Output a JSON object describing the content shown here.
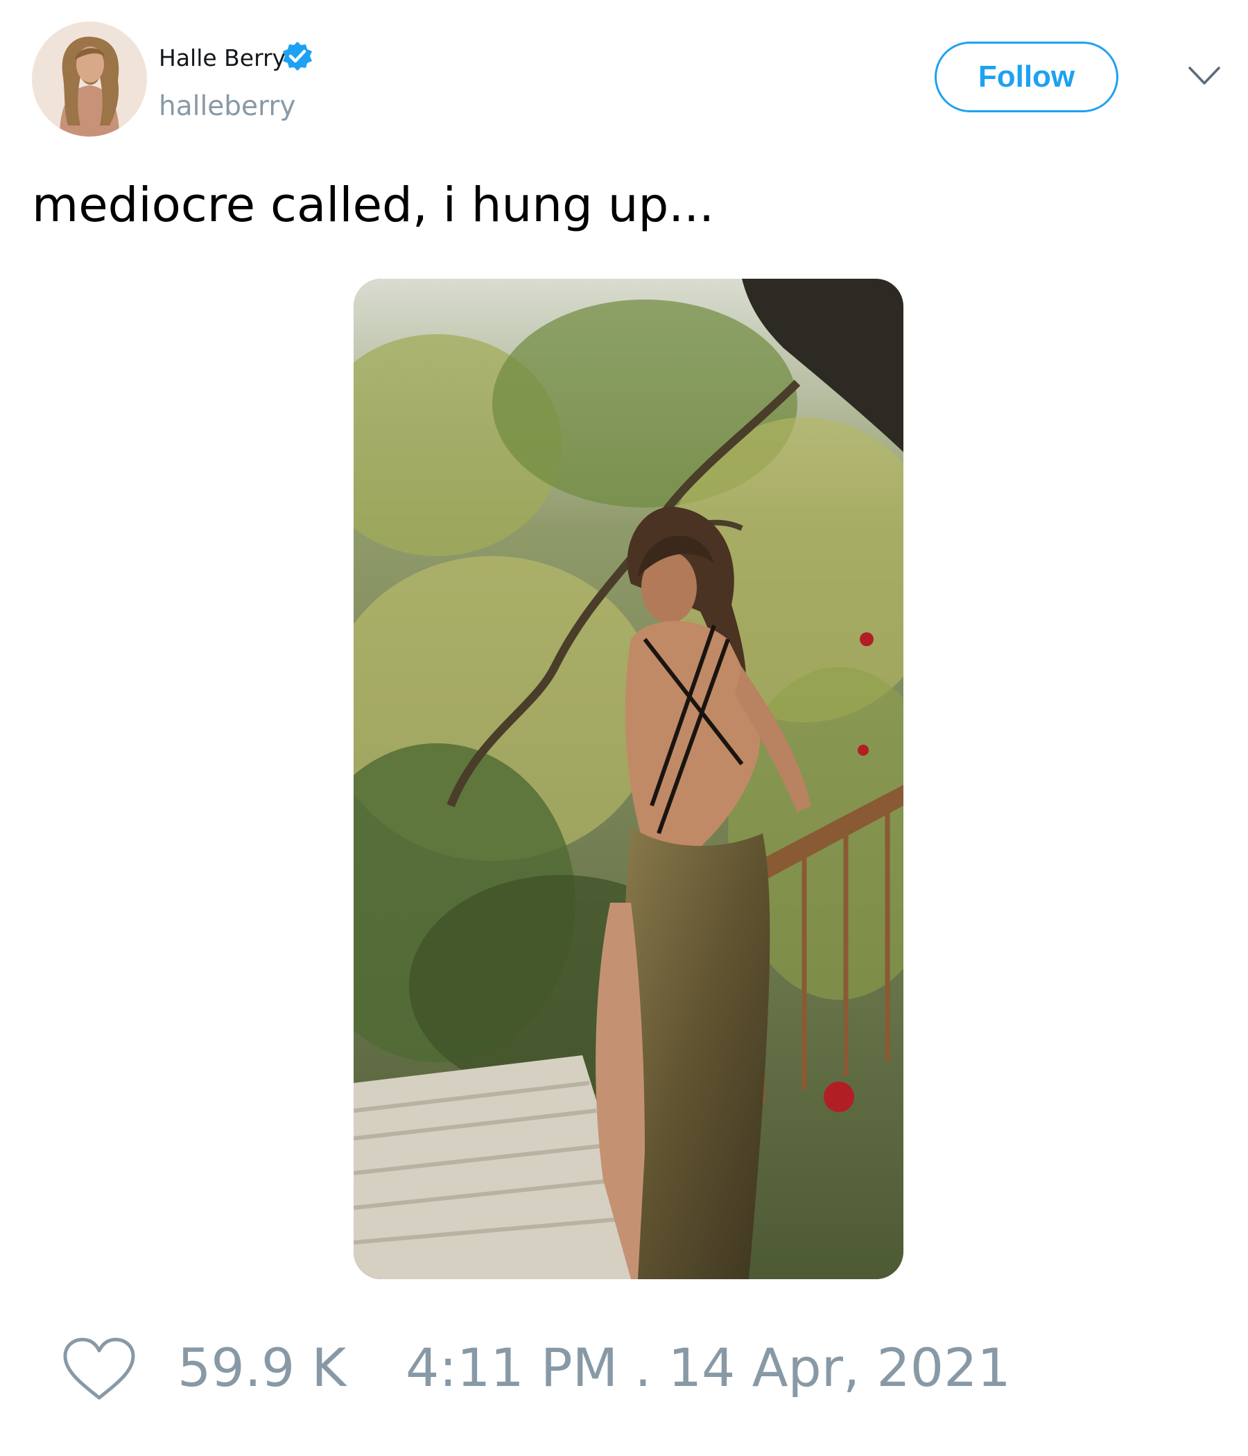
{
  "author": {
    "display_name": "Halle Berry",
    "handle": "halleberry",
    "verified": true,
    "avatar_icon": "profile-photo"
  },
  "follow_button": {
    "label": "Follow"
  },
  "menu": {
    "icon": "chevron-down-icon"
  },
  "tweet": {
    "text": "mediocre called, i hung up..."
  },
  "media": {
    "type": "photo"
  },
  "footer": {
    "like_icon": "heart-icon",
    "like_count": "59.9 K",
    "timestamp": "4:11 PM . 14 Apr, 2021"
  },
  "colors": {
    "accent": "#1da1f2",
    "muted_text": "#8899a6",
    "primary_text": "#14171a"
  }
}
